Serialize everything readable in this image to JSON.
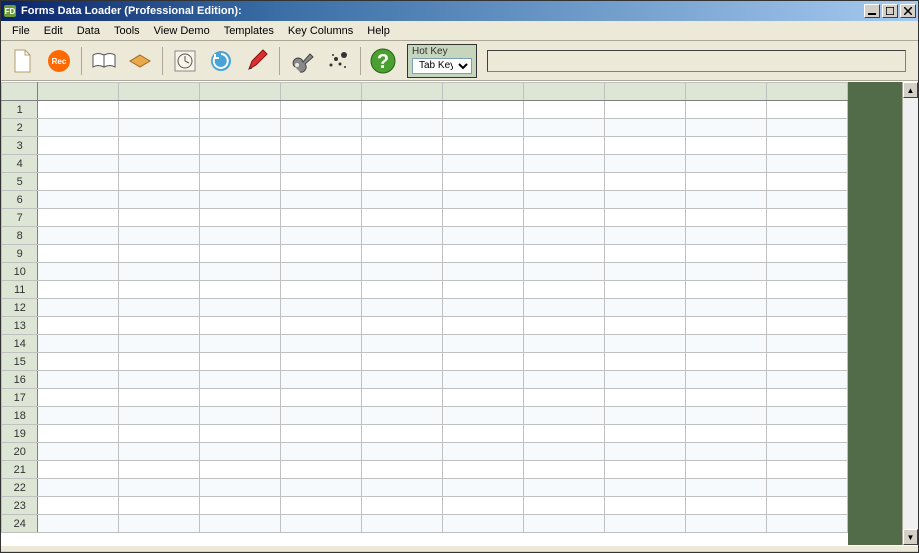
{
  "window": {
    "title": "Forms Data Loader (Professional Edition):"
  },
  "menubar": {
    "file": "File",
    "edit": "Edit",
    "data": "Data",
    "tools": "Tools",
    "view_demo": "View Demo",
    "templates": "Templates",
    "key_columns": "Key Columns",
    "help": "Help"
  },
  "toolbar": {
    "hotkey_label": "Hot Key",
    "hotkey_value": "Tab Key"
  },
  "grid": {
    "row_count": 24,
    "col_count": 10
  }
}
